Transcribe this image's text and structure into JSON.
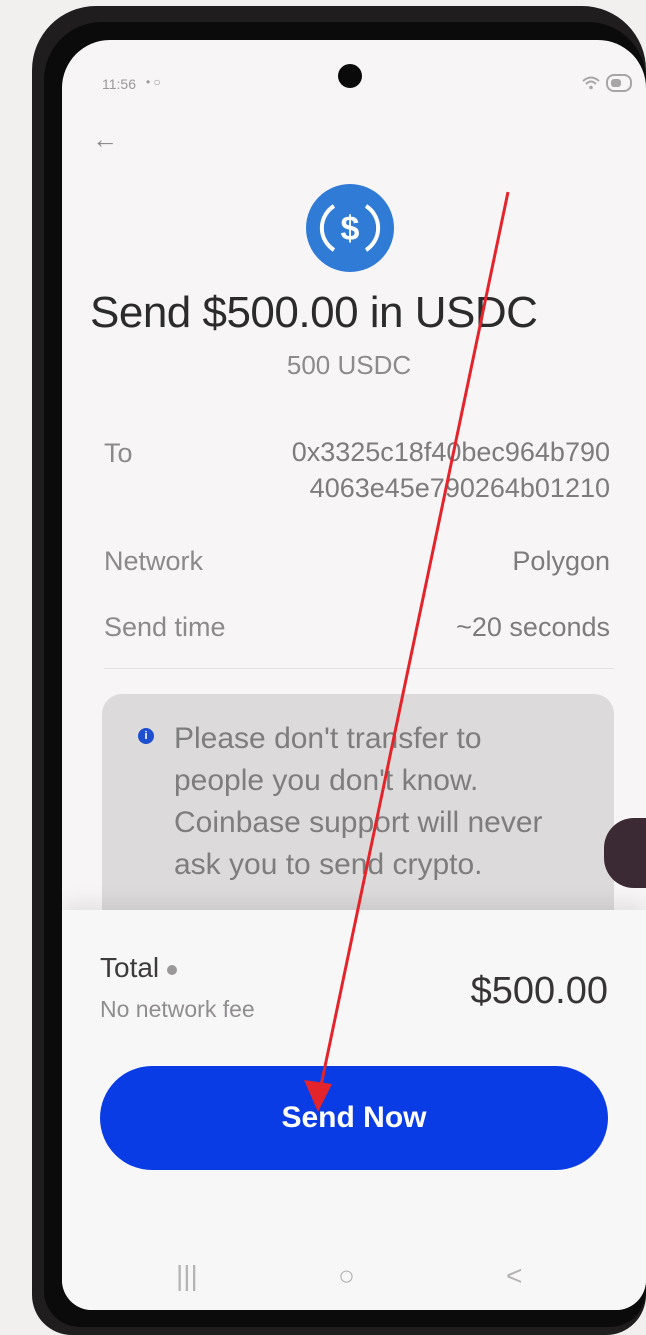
{
  "status_bar": {
    "time": "11:56",
    "left_icons": "• ○"
  },
  "header": {
    "back_glyph": "←",
    "title": "Send $500.00 in USDC",
    "subtitle": "500 USDC"
  },
  "details": {
    "to_label": "To",
    "to_address_line1": "0x3325c18f40bec964b790",
    "to_address_line2": "4063e45e790264b01210",
    "network_label": "Network",
    "network_value": "Polygon",
    "send_time_label": "Send time",
    "send_time_value": "~20 seconds"
  },
  "notice": {
    "icon_glyph": "i",
    "text": "Please don't transfer to people you don't know. Coinbase support will never ask you to send crypto."
  },
  "summary": {
    "total_label": "Total",
    "fee_text": "No network fee",
    "total_amount": "$500.00"
  },
  "actions": {
    "send_button_label": "Send Now"
  },
  "nav": {
    "recents_glyph": "|||",
    "home_glyph": "○",
    "back_glyph": "<"
  },
  "colors": {
    "accent": "#0a3ce6",
    "coin": "#2f7bd6",
    "annotation_arrow": "#e3242b"
  },
  "icons": {
    "coin": "usdc-coin-icon",
    "back": "back-arrow-icon",
    "info": "info-icon"
  }
}
